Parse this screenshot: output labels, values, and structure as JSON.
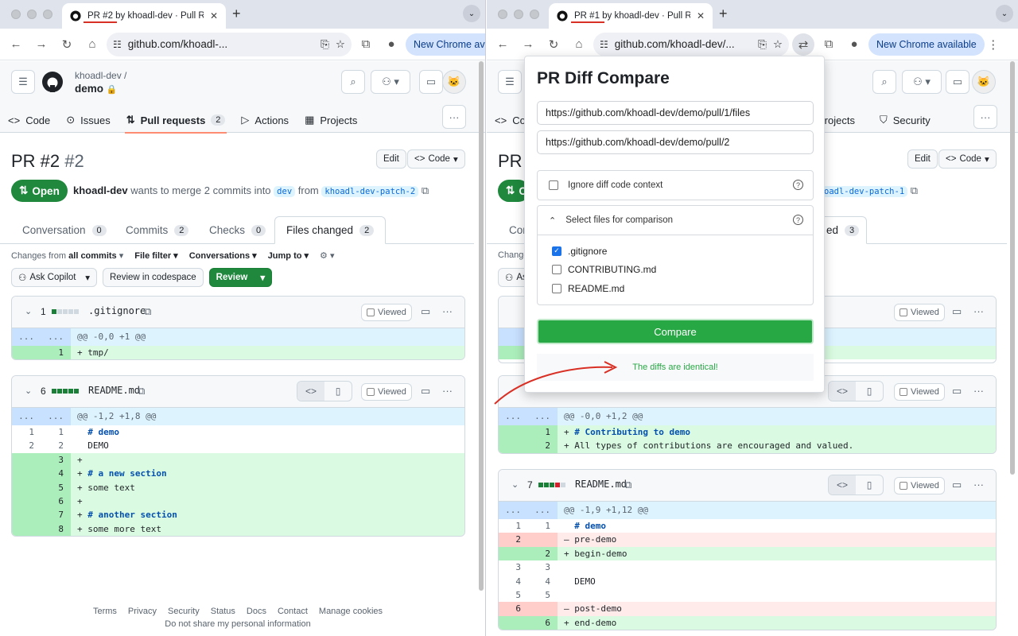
{
  "left": {
    "tab_title": "PR #2 by khoadl-dev · Pull Re",
    "url": "github.com/khoadl-...",
    "chrome_update": "New Chrome available",
    "owner": "khoadl-dev /",
    "repo": "demo",
    "nav": [
      "Code",
      "Issues",
      "Pull requests",
      "2",
      "Actions",
      "Projects"
    ],
    "pr_title": "PR #2",
    "pr_number": "#2",
    "edit": "Edit",
    "code": "Code",
    "state": "Open",
    "author": "khoadl-dev",
    "merge_text": "wants to merge 2 commits into",
    "base": "dev",
    "from": "from",
    "head": "khoadl-dev-patch-2",
    "tabs": [
      {
        "label": "Conversation",
        "count": "0"
      },
      {
        "label": "Commits",
        "count": "2"
      },
      {
        "label": "Checks",
        "count": "0"
      },
      {
        "label": "Files changed",
        "count": "2"
      }
    ],
    "filters": {
      "changes_from": "Changes from",
      "all_commits": "all commits",
      "file_filter": "File filter",
      "conversations": "Conversations",
      "jump_to": "Jump to"
    },
    "actions": {
      "ask_copilot": "Ask Copilot",
      "codespace": "Review in codespace",
      "review": "Review"
    },
    "files": [
      {
        "count": "1",
        "name": ".gitignore",
        "viewed": "Viewed",
        "lines": [
          {
            "t": "hunk",
            "a": "...",
            "b": "...",
            "c": "@@ -0,0 +1 @@"
          },
          {
            "t": "add",
            "a": "",
            "b": "1",
            "c": "+ tmp/"
          }
        ]
      },
      {
        "count": "6",
        "name": "README.md",
        "viewed": "Viewed",
        "lines": [
          {
            "t": "hunk",
            "a": "...",
            "b": "...",
            "c": "@@ -1,2 +1,8 @@"
          },
          {
            "t": "ctx",
            "a": "1",
            "b": "1",
            "c": "  # demo"
          },
          {
            "t": "ctx",
            "a": "2",
            "b": "2",
            "c": "  DEMO"
          },
          {
            "t": "add",
            "a": "",
            "b": "3",
            "c": "+"
          },
          {
            "t": "add",
            "a": "",
            "b": "4",
            "c": "+ # a new section"
          },
          {
            "t": "add",
            "a": "",
            "b": "5",
            "c": "+ some text"
          },
          {
            "t": "add",
            "a": "",
            "b": "6",
            "c": "+"
          },
          {
            "t": "add",
            "a": "",
            "b": "7",
            "c": "+ # another section"
          },
          {
            "t": "add",
            "a": "",
            "b": "8",
            "c": "+ some more text"
          }
        ]
      }
    ],
    "footer": {
      "links": [
        "Terms",
        "Privacy",
        "Security",
        "Status",
        "Docs",
        "Contact",
        "Manage cookies"
      ],
      "privacy": "Do not share my personal information"
    }
  },
  "right": {
    "tab_title": "PR #1 by khoadl-dev · Pull Re",
    "url": "github.com/khoadl-dev/...",
    "chrome_update": "New Chrome available",
    "nav": [
      "Co",
      "Projects",
      "Security"
    ],
    "pr_title_partial": "PR",
    "state_partial": "O",
    "head_partial": "oadl-dev-patch-1",
    "edit": "Edit",
    "code": "Code",
    "tab_partial": [
      "Con",
      "ed",
      "3"
    ],
    "changes_partial": "Change",
    "ask_partial": "As",
    "files": [
      {
        "name": "CONTRIBUTING.md",
        "viewed": "Viewed",
        "lines": [
          {
            "t": "hunk",
            "a": "...",
            "b": "...",
            "c": "@@ -0,0 +1,2 @@"
          },
          {
            "t": "add",
            "a": "",
            "b": "1",
            "c": "+ # Contributing to demo"
          },
          {
            "t": "add",
            "a": "",
            "b": "2",
            "c": "+ All types of contributions are encouraged and valued."
          }
        ]
      },
      {
        "count": "7",
        "name": "README.md",
        "viewed": "Viewed",
        "lines": [
          {
            "t": "hunk",
            "a": "...",
            "b": "...",
            "c": "@@ -1,9 +1,12 @@"
          },
          {
            "t": "ctx",
            "a": "1",
            "b": "1",
            "c": "  # demo"
          },
          {
            "t": "del",
            "a": "2",
            "b": "",
            "c": "– pre-demo"
          },
          {
            "t": "add",
            "a": "",
            "b": "2",
            "c": "+ begin-demo"
          },
          {
            "t": "ctx",
            "a": "3",
            "b": "3",
            "c": ""
          },
          {
            "t": "ctx",
            "a": "4",
            "b": "4",
            "c": "  DEMO"
          },
          {
            "t": "ctx",
            "a": "5",
            "b": "5",
            "c": ""
          },
          {
            "t": "del",
            "a": "6",
            "b": "",
            "c": "– post-demo"
          },
          {
            "t": "add",
            "a": "",
            "b": "6",
            "c": "+ end-demo"
          }
        ]
      }
    ]
  },
  "popup": {
    "title": "PR Diff Compare",
    "url1": "https://github.com/khoadl-dev/demo/pull/1/files",
    "url2": "https://github.com/khoadl-dev/demo/pull/2",
    "ignore_context": "Ignore diff code context",
    "select_files": "Select files for comparison",
    "files": [
      {
        "name": ".gitignore",
        "checked": true
      },
      {
        "name": "CONTRIBUTING.md",
        "checked": false
      },
      {
        "name": "README.md",
        "checked": false
      }
    ],
    "compare": "Compare",
    "result": "The diffs are identical!"
  },
  "colors": {
    "accent_green": "#1f883d",
    "annotation_red": "#d93025",
    "popup_green": "#28a745"
  }
}
